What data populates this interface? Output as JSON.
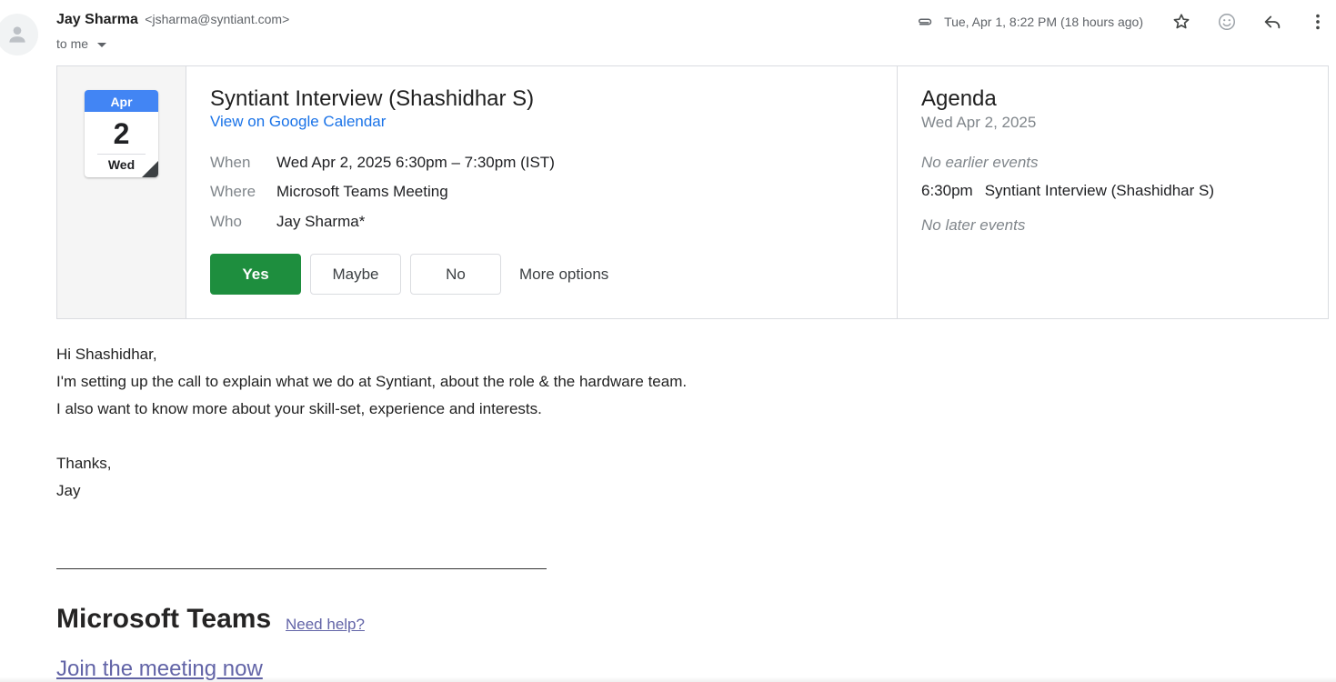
{
  "email": {
    "sender_name": "Jay Sharma",
    "sender_email": "<jsharma@syntiant.com>",
    "to_label": "to me",
    "date": "Tue, Apr 1, 8:22 PM (18 hours ago)"
  },
  "invite": {
    "cal_month": "Apr",
    "cal_day": "2",
    "cal_weekday": "Wed",
    "title": "Syntiant Interview (Shashidhar S)",
    "view_link": "View on Google Calendar",
    "when_label": "When",
    "when_value": "Wed Apr 2, 2025 6:30pm – 7:30pm (IST)",
    "where_label": "Where",
    "where_value": "Microsoft Teams Meeting",
    "who_label": "Who",
    "who_value": "Jay Sharma*",
    "yes_label": "Yes",
    "maybe_label": "Maybe",
    "no_label": "No",
    "more_options_label": "More options"
  },
  "agenda": {
    "title": "Agenda",
    "date": "Wed Apr 2, 2025",
    "no_earlier": "No earlier events",
    "event_time": "6:30pm",
    "event_title": "Syntiant Interview (Shashidhar S)",
    "no_later": "No later events"
  },
  "body": {
    "greeting": "Hi Shashidhar,",
    "line1": "I'm setting up the call to explain what we do at Syntiant, about the role & the hardware team.",
    "line2": "I also want to know more about your skill-set, experience and interests.",
    "thanks": "Thanks,",
    "signoff": "Jay"
  },
  "teams": {
    "title": "Microsoft Teams",
    "help_link": "Need help?",
    "join_link": "Join the meeting now"
  },
  "icons": {
    "attachment": "paperclip-icon",
    "star": "star-icon",
    "emoji": "emoji-icon",
    "reply": "reply-icon",
    "more": "more-vert-icon"
  },
  "colors": {
    "accept_green": "#1e8e3e",
    "calendar_blue": "#4285f4",
    "link_blue": "#1a73e8",
    "teams_purple": "#6264a7"
  }
}
